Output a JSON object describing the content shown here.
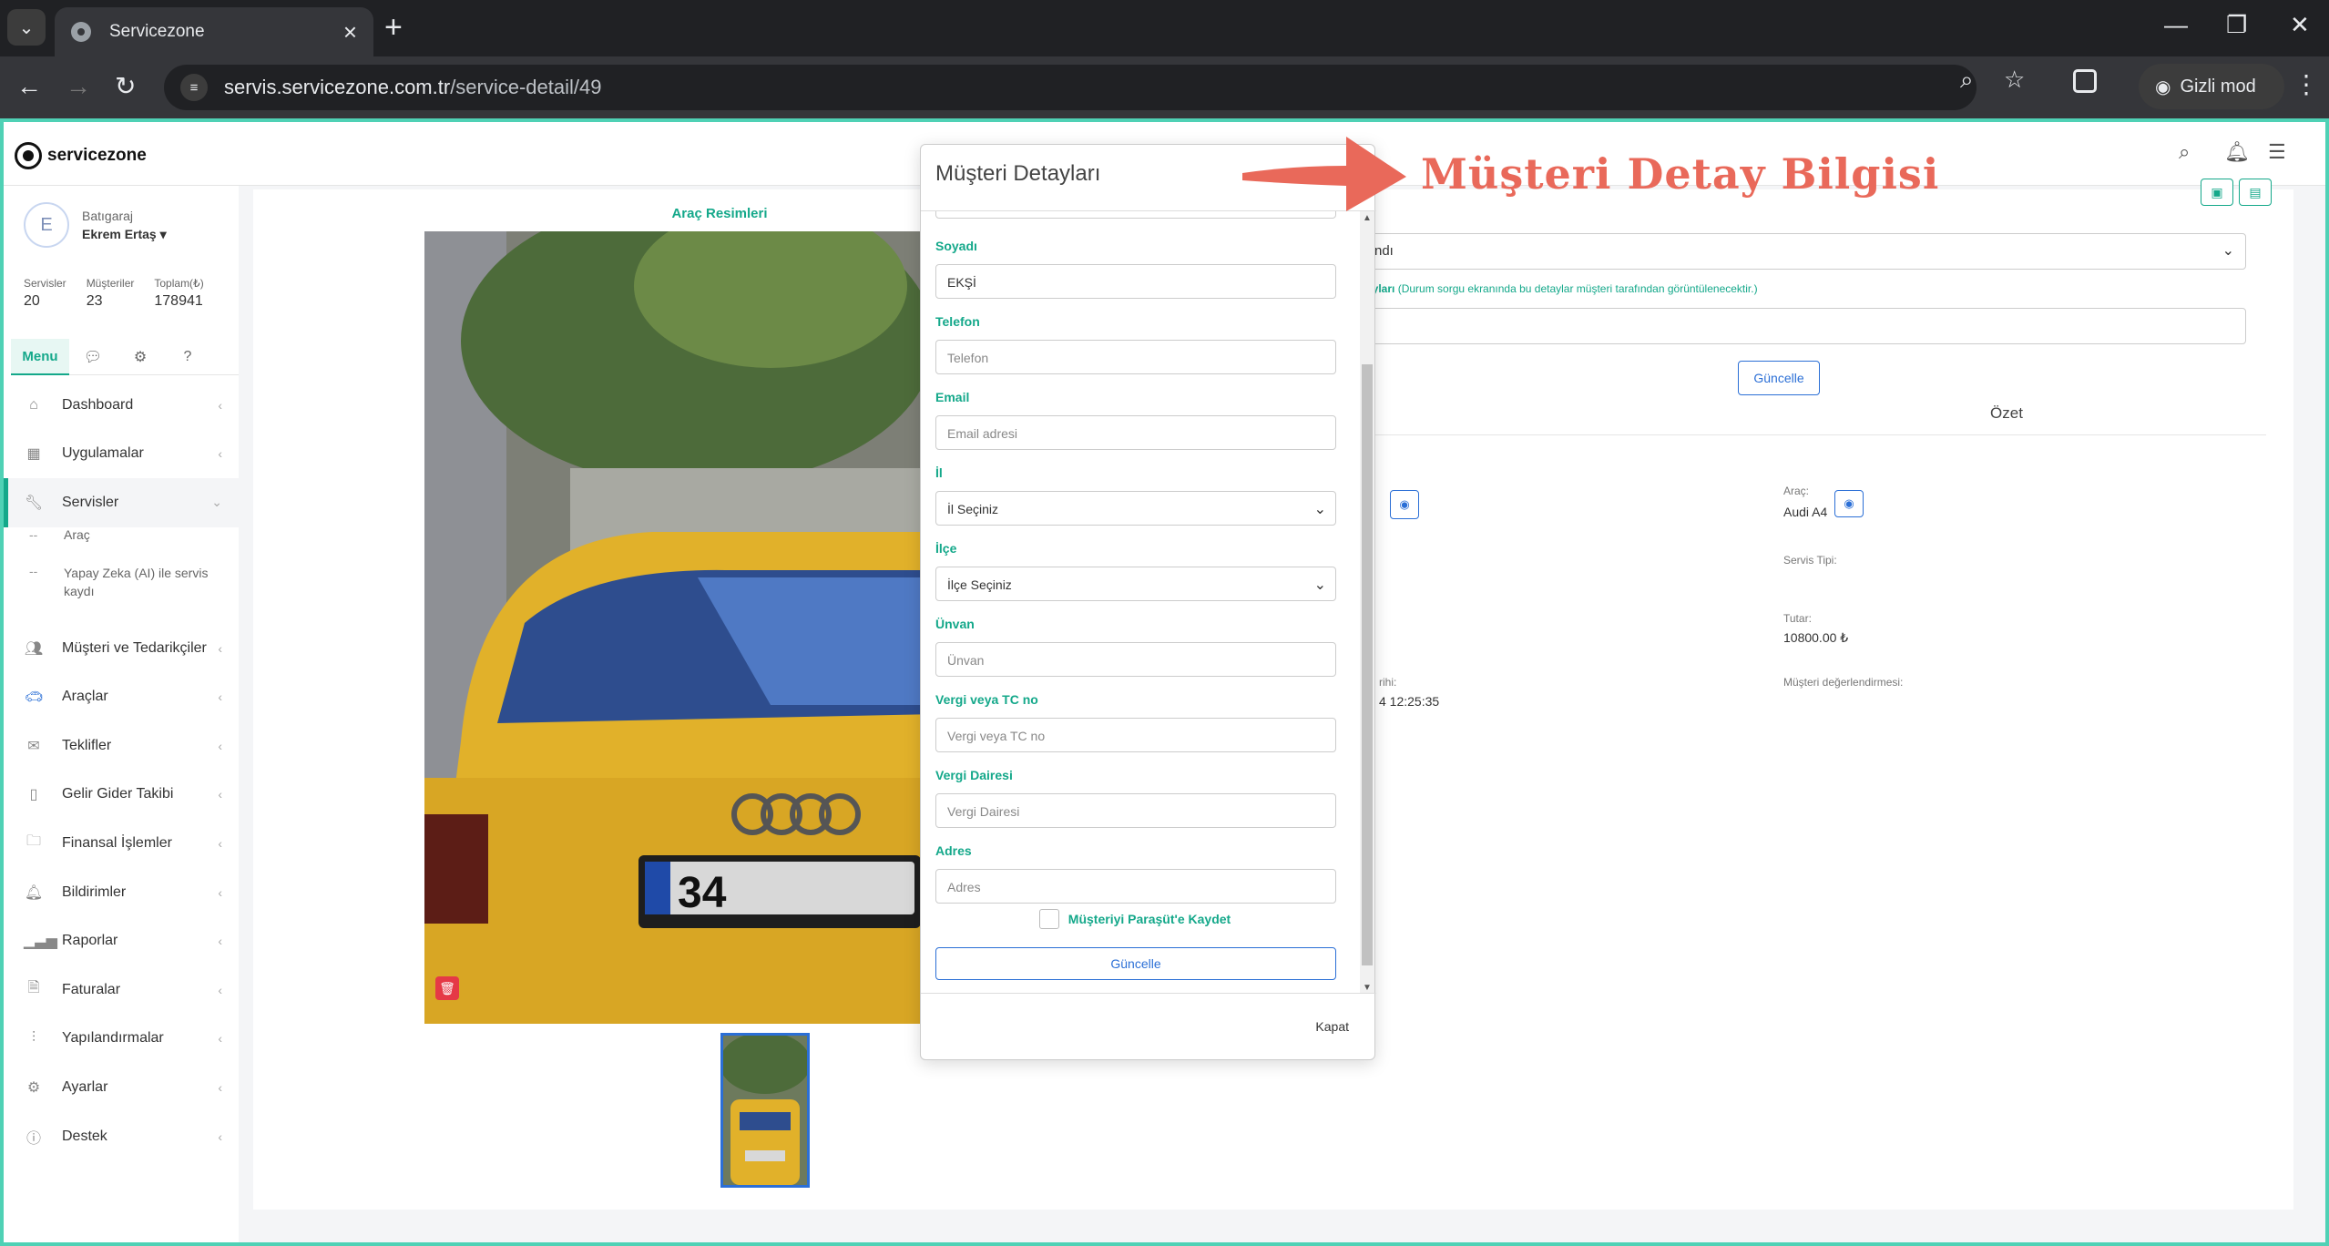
{
  "browser": {
    "tab_title": "Servicezone",
    "url_host": "servis.servicezone.com.tr",
    "url_path": "/service-detail/49",
    "incognito_label": "Gizli mod"
  },
  "app": {
    "brand": "servicezone",
    "user_company": "Batıgaraj",
    "user_name": "Ekrem Ertaş",
    "avatar_letter": "E",
    "stats": [
      {
        "label": "Servisler",
        "value": "20"
      },
      {
        "label": "Müşteriler",
        "value": "23"
      },
      {
        "label": "Toplam(₺)",
        "value": "178941"
      }
    ],
    "side_tab_menu": "Menu",
    "menu": [
      {
        "label": "Dashboard",
        "icon": "home-icon"
      },
      {
        "label": "Uygulamalar",
        "icon": "grid-icon"
      },
      {
        "label": "Servisler",
        "icon": "wrench-icon"
      },
      {
        "label": "Müşteri ve Tedarikçiler",
        "icon": "users-icon"
      },
      {
        "label": "Araçlar",
        "icon": "car-icon"
      },
      {
        "label": "Teklifler",
        "icon": "offer-icon"
      },
      {
        "label": "Gelir Gider Takibi",
        "icon": "book-icon"
      },
      {
        "label": "Finansal İşlemler",
        "icon": "folder-icon"
      },
      {
        "label": "Bildirimler",
        "icon": "bell-icon"
      },
      {
        "label": "Raporlar",
        "icon": "chart-icon"
      },
      {
        "label": "Faturalar",
        "icon": "file-icon"
      },
      {
        "label": "Yapılandırmalar",
        "icon": "sliders-icon"
      },
      {
        "label": "Ayarlar",
        "icon": "gear-icon"
      },
      {
        "label": "Destek",
        "icon": "info-icon"
      }
    ],
    "submenu": [
      {
        "dash": "--",
        "label": "Araç"
      },
      {
        "dash": "--",
        "label": "Yapay Zeka (AI) ile servis kaydı"
      }
    ]
  },
  "content": {
    "photos_title": "Araç Resimleri",
    "status_value": "ndı",
    "note_label_bold": "ayları",
    "note_label_hint": "(Durum sorgu ekranında bu detaylar müşteri tarafından görüntülenecektir.)",
    "update_button": "Güncelle",
    "summary_label": "Özet",
    "vehicle_label": "Araç:",
    "vehicle_value": "Audi A4",
    "service_type_label": "Servis Tipi:",
    "amount_label": "Tutar:",
    "amount_value": "10800.00 ₺",
    "date_label_partial": "rihi:",
    "date_value_partial": "4 12:25:35",
    "rating_label": "Müşteri değerlendirmesi:"
  },
  "modal": {
    "title": "Müşteri Detayları",
    "fields": [
      {
        "label": "Soyadı",
        "value": "EKŞİ",
        "placeholder": ""
      },
      {
        "label": "Telefon",
        "value": "",
        "placeholder": "Telefon"
      },
      {
        "label": "Email",
        "value": "",
        "placeholder": "Email adresi"
      },
      {
        "label": "İl",
        "value": "İl Seçiniz",
        "placeholder": ""
      },
      {
        "label": "İlçe",
        "value": "İlçe Seçiniz",
        "placeholder": ""
      },
      {
        "label": "Ünvan",
        "value": "",
        "placeholder": "Ünvan"
      },
      {
        "label": "Vergi veya TC no",
        "value": "",
        "placeholder": "Vergi veya TC no"
      },
      {
        "label": "Vergi Dairesi",
        "value": "",
        "placeholder": "Vergi Dairesi"
      },
      {
        "label": "Adres",
        "value": "",
        "placeholder": "Adres"
      }
    ],
    "checkbox_label": "Müşteriyi Paraşüt'e Kaydet",
    "update_button": "Güncelle",
    "close_button": "Kapat"
  },
  "annotation": {
    "text": "Müşteri Detay Bilgisi",
    "color": "#e9695a"
  },
  "colors": {
    "accent": "#14a88a",
    "frame": "#4fd1b5",
    "link_blue": "#2b6fd6"
  }
}
